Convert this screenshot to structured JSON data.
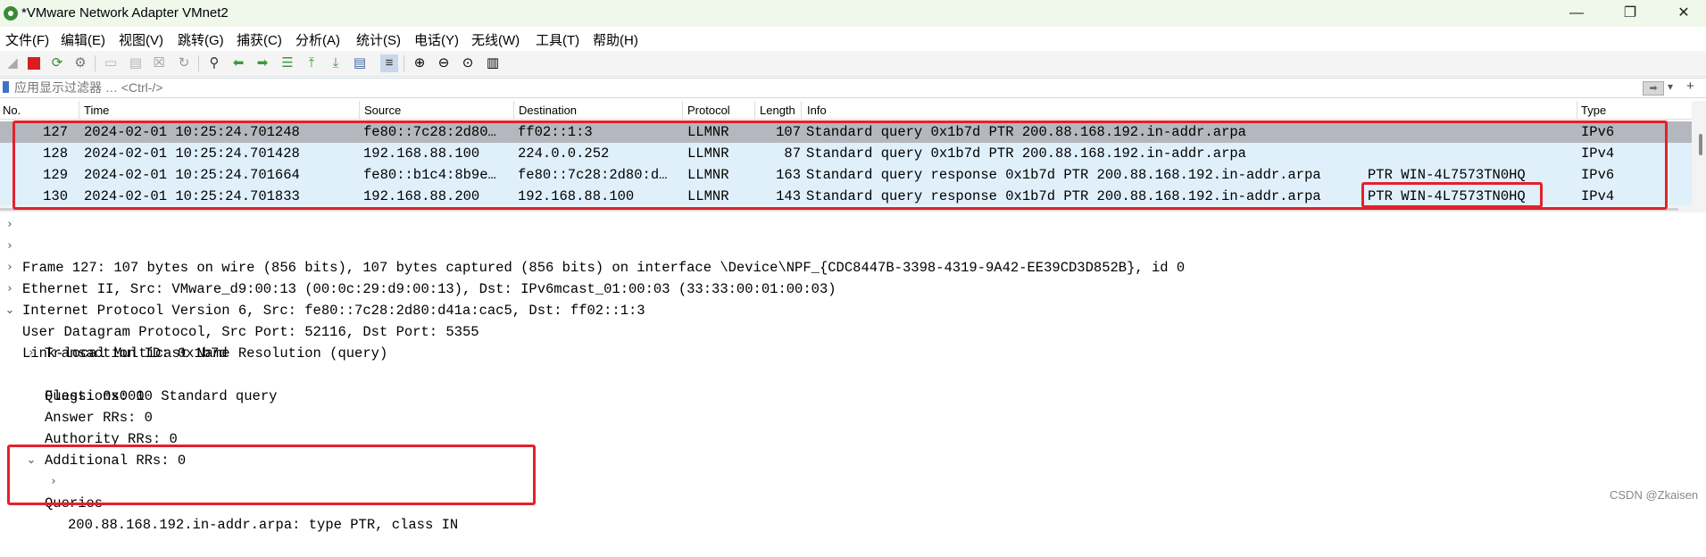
{
  "window": {
    "title": "*VMware Network Adapter VMnet2",
    "min": "—",
    "max": "❐",
    "close": "✕"
  },
  "menu": [
    "文件(F)",
    "编辑(E)",
    "视图(V)",
    "跳转(G)",
    "捕获(C)",
    "分析(A)",
    "统计(S)",
    "电话(Y)",
    "无线(W)",
    "工具(T)",
    "帮助(H)"
  ],
  "filter": {
    "placeholder": "应用显示过滤器 … <Ctrl-/>",
    "apply_icon": "arrow-right-icon",
    "add": "+"
  },
  "columns": [
    "No.",
    "Time",
    "Source",
    "Destination",
    "Protocol",
    "Length",
    "Info",
    "Type"
  ],
  "packets": [
    {
      "no": "127",
      "time": "2024-02-01 10:25:24.701248",
      "source": "fe80::7c28:2d80…",
      "destination": "ff02::1:3",
      "protocol": "LLMNR",
      "length": "107",
      "info": "Standard query 0x1b7d PTR 200.88.168.192.in-addr.arpa",
      "info_extra": "",
      "type": "IPv6"
    },
    {
      "no": "128",
      "time": "2024-02-01 10:25:24.701428",
      "source": "192.168.88.100",
      "destination": "224.0.0.252",
      "protocol": "LLMNR",
      "length": "87",
      "info": "Standard query 0x1b7d PTR 200.88.168.192.in-addr.arpa",
      "info_extra": "",
      "type": "IPv4"
    },
    {
      "no": "129",
      "time": "2024-02-01 10:25:24.701664",
      "source": "fe80::b1c4:8b9e…",
      "destination": "fe80::7c28:2d80:d…",
      "protocol": "LLMNR",
      "length": "163",
      "info": "Standard query response 0x1b7d PTR 200.88.168.192.in-addr.arpa",
      "info_extra": "PTR WIN-4L7573TN0HQ",
      "type": "IPv6"
    },
    {
      "no": "130",
      "time": "2024-02-01 10:25:24.701833",
      "source": "192.168.88.200",
      "destination": "192.168.88.100",
      "protocol": "LLMNR",
      "length": "143",
      "info": "Standard query response 0x1b7d PTR 200.88.168.192.in-addr.arpa",
      "info_extra": "PTR WIN-4L7573TN0HQ",
      "type": "IPv4"
    }
  ],
  "details": [
    {
      "text": "Frame 127: 107 bytes on wire (856 bits), 107 bytes captured (856 bits) on interface \\Device\\NPF_{CDC8447B-3398-4319-9A42-EE39CD3D852B}, id 0",
      "arrow": "›"
    },
    {
      "text": "Ethernet II, Src: VMware_d9:00:13 (00:0c:29:d9:00:13), Dst: IPv6mcast_01:00:03 (33:33:00:01:00:03)",
      "arrow": "›"
    },
    {
      "text": "Internet Protocol Version 6, Src: fe80::7c28:2d80:d41a:cac5, Dst: ff02::1:3",
      "arrow": "›"
    },
    {
      "text": "User Datagram Protocol, Src Port: 52116, Dst Port: 5355",
      "arrow": "›"
    },
    {
      "text": "Link-local Multicast Name Resolution (query)",
      "arrow": "⌄"
    },
    {
      "text": "Transaction ID: 0x1b7d",
      "arrow": ""
    },
    {
      "text": "Flags: 0x0000 Standard query",
      "arrow": "›"
    },
    {
      "text": "Questions: 1",
      "arrow": ""
    },
    {
      "text": "Answer RRs: 0",
      "arrow": ""
    },
    {
      "text": "Authority RRs: 0",
      "arrow": ""
    },
    {
      "text": "Additional RRs: 0",
      "arrow": ""
    },
    {
      "text": "Queries",
      "arrow": "⌄"
    },
    {
      "text": "200.88.168.192.in-addr.arpa: type PTR, class IN",
      "arrow": "›"
    }
  ],
  "watermark": "CSDN @Zkaisen",
  "colors": {
    "highlight": "#e3212b",
    "row_bg": "#dff0fb",
    "selected_bg": "#b4b8be"
  }
}
